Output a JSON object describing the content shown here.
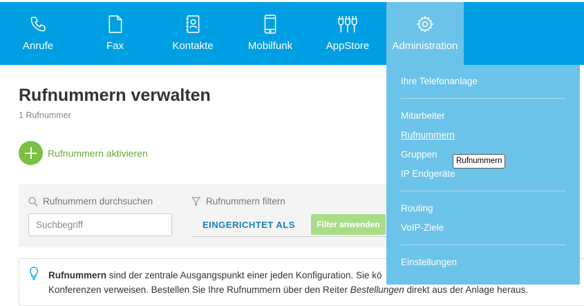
{
  "nav": {
    "items": [
      {
        "label": "Anrufe",
        "icon": "phone-icon"
      },
      {
        "label": "Fax",
        "icon": "document-icon"
      },
      {
        "label": "Kontakte",
        "icon": "address-book-icon"
      },
      {
        "label": "Mobilfunk",
        "icon": "mobile-phone-icon"
      },
      {
        "label": "AppStore",
        "icon": "plug-icon"
      },
      {
        "label": "Administration",
        "icon": "gear-icon"
      }
    ],
    "active": "Administration"
  },
  "dropdown": {
    "items": {
      "telefonanlage": "Ihre Telefonanlage",
      "mitarbeiter": "Mitarbeiter",
      "rufnummern": "Rufnummern",
      "gruppen": "Gruppen",
      "endgeraete": "IP Endgeräte",
      "routing": "Routing",
      "voip": "VoIP-Ziele",
      "einstellungen": "Einstellungen"
    },
    "selected": "Rufnummern"
  },
  "tooltip": "Rufnummern",
  "page": {
    "title": "Rufnummern verwalten",
    "subtitle": "1 Rufnummer",
    "activate_label": "Rufnummern aktivieren"
  },
  "filters": {
    "search_label": "Rufnummern durchsuchen",
    "search_placeholder": "Suchbegriff",
    "filter_label": "Rufnummern filtern",
    "tab_label": "EINGERICHTET ALS",
    "apply_label": "Filter anwenden"
  },
  "info": {
    "bold": "Rufnummern",
    "text1": " sind der zentrale Ausgangspunkt einer jeden Konfiguration. Sie kö",
    "text2": "Konferenzen verweisen. Bestellen Sie Ihre Rufnummern über den Reiter ",
    "italic": "Bestellungen",
    "text3": " direkt aus der Anlage heraus."
  },
  "colors": {
    "navbar": "#009fe3",
    "active_tab": "#6cc3ea",
    "accent_green": "#7ac143",
    "link_blue": "#1a7fb8"
  }
}
